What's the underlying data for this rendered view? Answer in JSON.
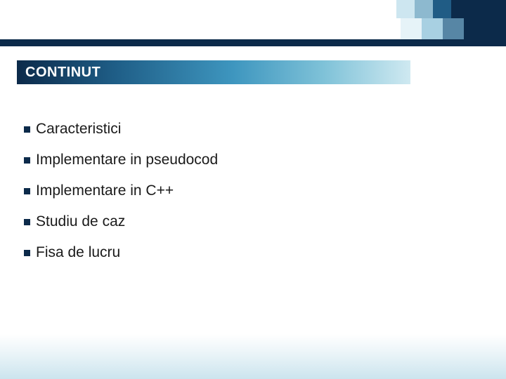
{
  "title": "CONTINUT",
  "items": [
    "Caracteristici",
    "Implementare in pseudocod",
    "Implementare in C++",
    "Studiu de caz",
    "Fisa de lucru"
  ],
  "colors": {
    "dark": "#0c2a4a",
    "accent": "#3e96bf"
  }
}
